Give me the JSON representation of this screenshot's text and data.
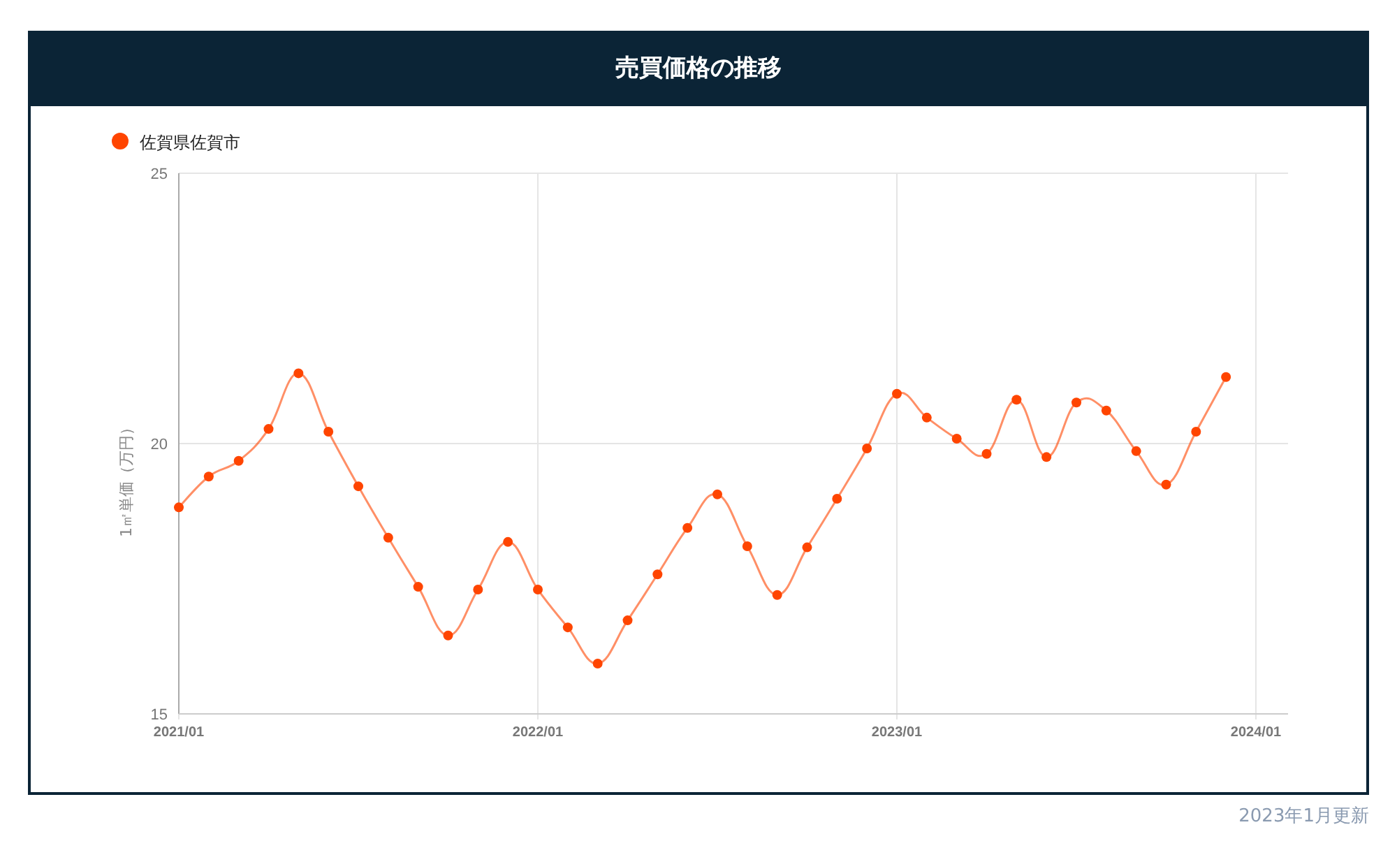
{
  "card": {
    "title": "売買価格の推移",
    "chart_data": {
      "type": "line",
      "ylabel": "1㎡単価（万円）",
      "categories": [
        "2021/01",
        null,
        null,
        null,
        null,
        null,
        null,
        null,
        null,
        null,
        null,
        null,
        "2022/01",
        null,
        null,
        null,
        null,
        null,
        null,
        null,
        null,
        null,
        null,
        null,
        "2023/01",
        null,
        null,
        null,
        null,
        null,
        null,
        null,
        null,
        null,
        null,
        null,
        "2024/01"
      ],
      "grid": true,
      "series": [
        {
          "name": "佐賀県佐賀市",
          "color": "#ff4500",
          "marker": true,
          "values": [
            18.82,
            19.39,
            19.68,
            20.27,
            21.3,
            20.22,
            19.21,
            18.26,
            17.35,
            16.45,
            17.3,
            18.18,
            17.3,
            16.6,
            15.93,
            16.73,
            17.58,
            18.44,
            19.06,
            18.1,
            17.2,
            18.08,
            18.98,
            19.91,
            20.92,
            20.48,
            20.09,
            19.81,
            20.81,
            19.75,
            20.76,
            20.61,
            19.86,
            19.24,
            20.22,
            21.23,
            null
          ]
        }
      ],
      "ylim": [
        15,
        25
      ],
      "yticks": [
        15,
        20,
        25
      ]
    }
  },
  "updated": "2023年1月更新"
}
